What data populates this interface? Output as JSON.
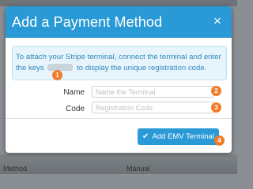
{
  "modal": {
    "title": "Add a Payment Method",
    "close_glyph": "×",
    "close_icon": "close-icon"
  },
  "info": {
    "text_before": "To attach your Stripe terminal, connect the terminal and enter the keys",
    "text_after": "to display the unique registration code."
  },
  "form": {
    "name_label": "Name",
    "name_placeholder": "Name the Terminal",
    "name_value": "",
    "code_label": "Code",
    "code_placeholder": "Registration Code",
    "code_value": ""
  },
  "actions": {
    "submit_label": "Add EMV Terminal",
    "submit_icon": "check-icon"
  },
  "markers": [
    "1",
    "2",
    "3",
    "4"
  ],
  "background": {
    "left_label": "Method",
    "right_label": "Manual"
  },
  "colors": {
    "accent": "#2a9ad6",
    "info_background": "#e7f4fc",
    "info_text": "#2f88bd",
    "marker": "#f07c2a"
  }
}
